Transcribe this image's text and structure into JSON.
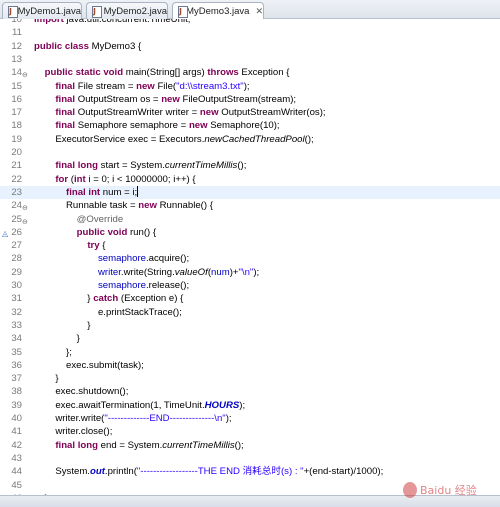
{
  "tabs": [
    {
      "label": "MyDemo1.java",
      "active": false
    },
    {
      "label": "MyDemo2.java",
      "active": false
    },
    {
      "label": "*MyDemo3.java",
      "active": true
    }
  ],
  "lines": [
    {
      "num": "10",
      "segs": [
        {
          "t": "import",
          "c": "kw"
        },
        {
          "t": " java.util.concurrent.TimeUnit;"
        }
      ]
    },
    {
      "num": "11",
      "segs": []
    },
    {
      "num": "12",
      "segs": [
        {
          "t": "public",
          "c": "kw"
        },
        {
          "t": " "
        },
        {
          "t": "class",
          "c": "kw"
        },
        {
          "t": " MyDemo3 {"
        }
      ]
    },
    {
      "num": "13",
      "segs": []
    },
    {
      "num": "14",
      "fold": "⊖",
      "segs": [
        {
          "t": "    "
        },
        {
          "t": "public",
          "c": "kw"
        },
        {
          "t": " "
        },
        {
          "t": "static",
          "c": "kw"
        },
        {
          "t": " "
        },
        {
          "t": "void",
          "c": "kw"
        },
        {
          "t": " main(String[] args) "
        },
        {
          "t": "throws",
          "c": "kw"
        },
        {
          "t": " Exception {"
        }
      ]
    },
    {
      "num": "15",
      "segs": [
        {
          "t": "        "
        },
        {
          "t": "final",
          "c": "kw"
        },
        {
          "t": " File stream = "
        },
        {
          "t": "new",
          "c": "kw"
        },
        {
          "t": " File("
        },
        {
          "t": "\"d:\\\\stream3.txt\"",
          "c": "str"
        },
        {
          "t": ");"
        }
      ]
    },
    {
      "num": "16",
      "segs": [
        {
          "t": "        "
        },
        {
          "t": "final",
          "c": "kw"
        },
        {
          "t": " OutputStream os = "
        },
        {
          "t": "new",
          "c": "kw"
        },
        {
          "t": " FileOutputStream(stream);"
        }
      ]
    },
    {
      "num": "17",
      "segs": [
        {
          "t": "        "
        },
        {
          "t": "final",
          "c": "kw"
        },
        {
          "t": " OutputStreamWriter writer = "
        },
        {
          "t": "new",
          "c": "kw"
        },
        {
          "t": " OutputStreamWriter(os);"
        }
      ]
    },
    {
      "num": "18",
      "segs": [
        {
          "t": "        "
        },
        {
          "t": "final",
          "c": "kw"
        },
        {
          "t": " Semaphore semaphore = "
        },
        {
          "t": "new",
          "c": "kw"
        },
        {
          "t": " Semaphore(10);"
        }
      ]
    },
    {
      "num": "19",
      "segs": [
        {
          "t": "        ExecutorService exec = Executors."
        },
        {
          "t": "newCachedThreadPool",
          "c": "it"
        },
        {
          "t": "();"
        }
      ]
    },
    {
      "num": "20",
      "segs": []
    },
    {
      "num": "21",
      "segs": [
        {
          "t": "        "
        },
        {
          "t": "final",
          "c": "kw"
        },
        {
          "t": " "
        },
        {
          "t": "long",
          "c": "kw"
        },
        {
          "t": " start = System."
        },
        {
          "t": "currentTimeMillis",
          "c": "it"
        },
        {
          "t": "();"
        }
      ]
    },
    {
      "num": "22",
      "segs": [
        {
          "t": "        "
        },
        {
          "t": "for",
          "c": "kw"
        },
        {
          "t": " ("
        },
        {
          "t": "int",
          "c": "kw"
        },
        {
          "t": " i = 0; i < 10000000; i++) {"
        }
      ]
    },
    {
      "num": "23",
      "current": true,
      "segs": [
        {
          "t": "            "
        },
        {
          "t": "final",
          "c": "kw"
        },
        {
          "t": " "
        },
        {
          "t": "int",
          "c": "kw"
        },
        {
          "t": " num = i;"
        }
      ]
    },
    {
      "num": "24",
      "fold": "⊖",
      "segs": [
        {
          "t": "            Runnable task = "
        },
        {
          "t": "new",
          "c": "kw"
        },
        {
          "t": " Runnable() {"
        }
      ]
    },
    {
      "num": "25",
      "fold": "⊖",
      "segs": [
        {
          "t": "                "
        },
        {
          "t": "@Override",
          "c": "ann"
        }
      ]
    },
    {
      "num": "26",
      "marker": "◬",
      "segs": [
        {
          "t": "                "
        },
        {
          "t": "public",
          "c": "kw"
        },
        {
          "t": " "
        },
        {
          "t": "void",
          "c": "kw"
        },
        {
          "t": " run() {"
        }
      ]
    },
    {
      "num": "27",
      "segs": [
        {
          "t": "                    "
        },
        {
          "t": "try",
          "c": "kw"
        },
        {
          "t": " {"
        }
      ]
    },
    {
      "num": "28",
      "segs": [
        {
          "t": "                        "
        },
        {
          "t": "semaphore",
          "c": "fld"
        },
        {
          "t": ".acquire();"
        }
      ]
    },
    {
      "num": "29",
      "segs": [
        {
          "t": "                        "
        },
        {
          "t": "writer",
          "c": "fld"
        },
        {
          "t": ".write(String."
        },
        {
          "t": "valueOf",
          "c": "it"
        },
        {
          "t": "("
        },
        {
          "t": "num",
          "c": "fld"
        },
        {
          "t": ")+"
        },
        {
          "t": "\"\\n\"",
          "c": "str"
        },
        {
          "t": ");"
        }
      ]
    },
    {
      "num": "30",
      "segs": [
        {
          "t": "                        "
        },
        {
          "t": "semaphore",
          "c": "fld"
        },
        {
          "t": ".release();"
        }
      ]
    },
    {
      "num": "31",
      "segs": [
        {
          "t": "                    } "
        },
        {
          "t": "catch",
          "c": "kw"
        },
        {
          "t": " (Exception e) {"
        }
      ]
    },
    {
      "num": "32",
      "segs": [
        {
          "t": "                        e.printStackTrace();"
        }
      ]
    },
    {
      "num": "33",
      "segs": [
        {
          "t": "                    }"
        }
      ]
    },
    {
      "num": "34",
      "segs": [
        {
          "t": "                }"
        }
      ]
    },
    {
      "num": "35",
      "segs": [
        {
          "t": "            };"
        }
      ]
    },
    {
      "num": "36",
      "segs": [
        {
          "t": "            exec.submit(task);"
        }
      ]
    },
    {
      "num": "37",
      "segs": [
        {
          "t": "        }"
        }
      ]
    },
    {
      "num": "38",
      "segs": [
        {
          "t": "        exec.shutdown();"
        }
      ]
    },
    {
      "num": "39",
      "segs": [
        {
          "t": "        exec.awaitTermination(1, TimeUnit."
        },
        {
          "t": "HOURS",
          "c": "stf"
        },
        {
          "t": ");"
        }
      ]
    },
    {
      "num": "40",
      "segs": [
        {
          "t": "        writer.write("
        },
        {
          "t": "\"-------------END--------------\\n\"",
          "c": "str"
        },
        {
          "t": ");"
        }
      ]
    },
    {
      "num": "41",
      "segs": [
        {
          "t": "        writer.close();"
        }
      ]
    },
    {
      "num": "42",
      "segs": [
        {
          "t": "        "
        },
        {
          "t": "final",
          "c": "kw"
        },
        {
          "t": " "
        },
        {
          "t": "long",
          "c": "kw"
        },
        {
          "t": " end = System."
        },
        {
          "t": "currentTimeMillis",
          "c": "it"
        },
        {
          "t": "();"
        }
      ]
    },
    {
      "num": "43",
      "segs": []
    },
    {
      "num": "44",
      "segs": [
        {
          "t": "        System."
        },
        {
          "t": "out",
          "c": "stf"
        },
        {
          "t": ".println("
        },
        {
          "t": "\"------------------THE END 消耗总时(s) : \"",
          "c": "str"
        },
        {
          "t": "+(end-start)/1000);"
        }
      ]
    },
    {
      "num": "45",
      "segs": []
    },
    {
      "num": "46",
      "segs": [
        {
          "t": "    }"
        }
      ]
    }
  ],
  "watermark_text": "Baidu 经验"
}
